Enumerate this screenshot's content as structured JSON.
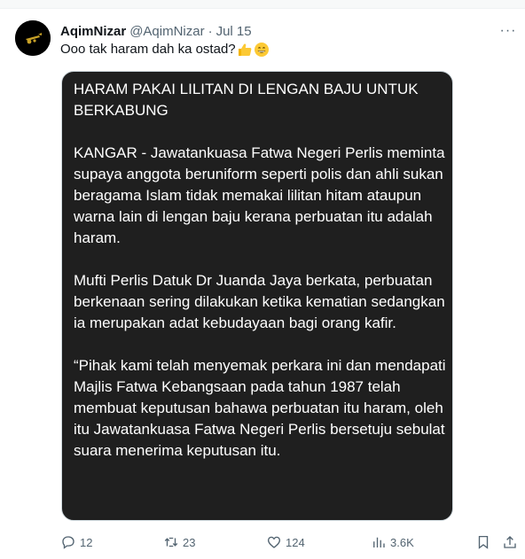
{
  "author": {
    "display_name": "AqimNizar",
    "handle": "@AqimNizar",
    "separator": "·",
    "date": "Jul 15"
  },
  "tweet": {
    "text": "Ooo tak haram dah ka ostad?",
    "emojis": [
      "thumbs-up-icon",
      "grinning-face-icon"
    ]
  },
  "media": {
    "paragraphs": [
      "HARAM PAKAI LILITAN DI LENGAN BAJU UNTUK BERKABUNG",
      "KANGAR - Jawatankuasa Fatwa Negeri Perlis meminta supaya anggota beruniform seperti polis dan ahli sukan beragama Islam tidak memakai lilitan hitam ataupun warna lain di lengan baju kerana perbuatan itu adalah haram.",
      "Mufti Perlis Datuk Dr Juanda Jaya berkata, perbuatan berkenaan sering dilakukan ketika kematian sedangkan ia merupakan adat kebudayaan bagi orang kafir.",
      "“Pihak kami telah menyemak perkara ini dan mendapati Majlis Fatwa Kebangsaan pada tahun 1987 telah membuat keputusan bahawa perbuatan itu haram, oleh itu Jawatankuasa Fatwa Negeri Perlis bersetuju sebulat suara menerima keputusan itu."
    ]
  },
  "actions": {
    "replies": "12",
    "retweets": "23",
    "likes": "124",
    "views": "3.6K"
  },
  "menu": {
    "more_label": "···"
  },
  "colors": {
    "text_primary": "#0f1419",
    "text_secondary": "#536471",
    "media_bg": "#1f1f1f",
    "border": "#cfd9de"
  }
}
